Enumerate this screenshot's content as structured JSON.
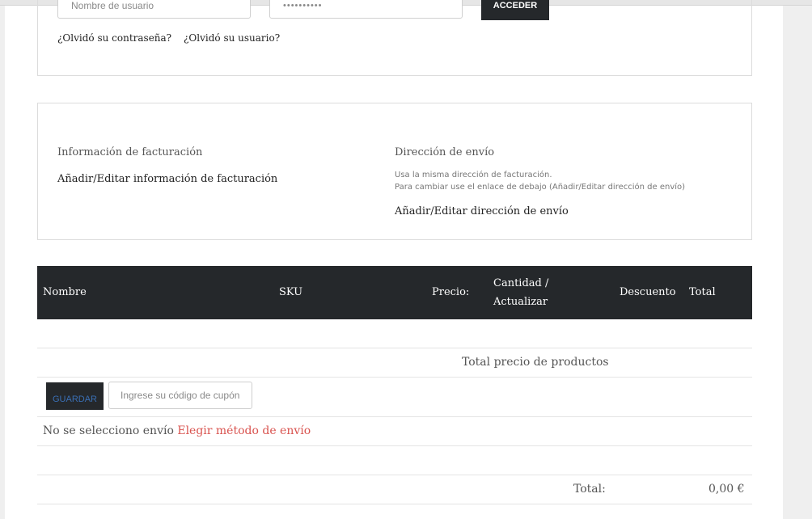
{
  "login": {
    "username_placeholder": "Nombre de usuario",
    "password_value": "••••••••••",
    "login_button": "ACCEDER",
    "forgot_password": "¿Olvidó su contraseña?",
    "forgot_username": "¿Olvidó su usuario?"
  },
  "billing": {
    "title": "Información de facturación",
    "edit_link": "Añadir/Editar información de facturación"
  },
  "shipping": {
    "title": "Dirección de envío",
    "note_line1": "Usa la misma dirección de facturación.",
    "note_line2": "Para cambiar use el enlace de debajo (Añadir/Editar dirección de envío)",
    "edit_link": "Añadir/Editar dirección de envío"
  },
  "table": {
    "headers": {
      "name": "Nombre",
      "sku": "SKU",
      "price": "Precio:",
      "qty_line1": "Cantidad /",
      "qty_line2": "Actualizar",
      "discount": "Descuento",
      "total": "Total"
    }
  },
  "summary": {
    "products_total_label": "Total precio de productos",
    "save_button": "GUARDAR",
    "coupon_placeholder": "Ingrese su código de cupón",
    "no_shipping_text": "No se selecciono envío",
    "choose_shipping_link": "Elegir método de envío",
    "total_label": "Total:",
    "total_value": "0,00 €"
  },
  "colors": {
    "dark": "#25282b",
    "link_red": "#d9534f",
    "save_text": "#3a6fb4"
  }
}
